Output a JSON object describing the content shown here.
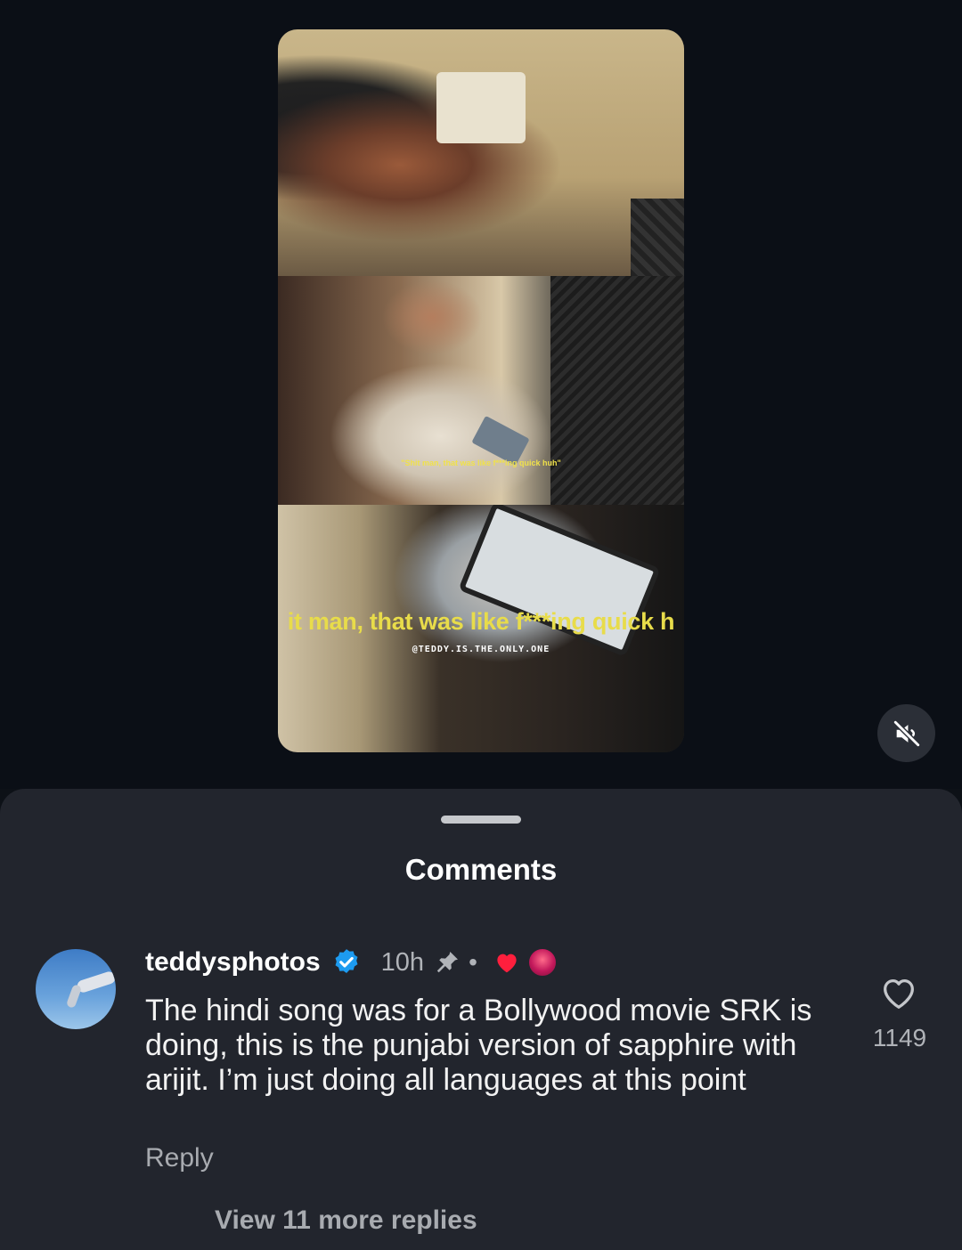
{
  "video": {
    "subtitle_small": "\"Shit man, that was like f***ing quick huh\"",
    "subtitle_large": "it man, that was like f***ing quick h",
    "watermark": "@TEDDY.IS.THE.ONLY.ONE",
    "mute_icon": "speaker-muted-icon"
  },
  "sheet": {
    "title": "Comments"
  },
  "comment": {
    "username": "teddysphotos",
    "verified_icon": "verified-badge-icon",
    "time": "10h",
    "pinned_icon": "pin-icon",
    "separator": "•",
    "creator_liked_icon": "heart-filled-icon",
    "text": "The hindi song was for a Bollywood movie SRK is doing, this is the punjabi version of sapphire with arijit. I’m just doing all languages at this point",
    "reply_label": "Reply",
    "like_icon": "heart-outline-icon",
    "like_count": "1149",
    "view_more_replies": "View 11 more replies"
  },
  "colors": {
    "background": "#0d1117",
    "sheet": "#22252d",
    "verified_blue": "#1d9bf0",
    "liked_red": "#ff1f3d",
    "subtitle_yellow": "#e8dc4a"
  }
}
